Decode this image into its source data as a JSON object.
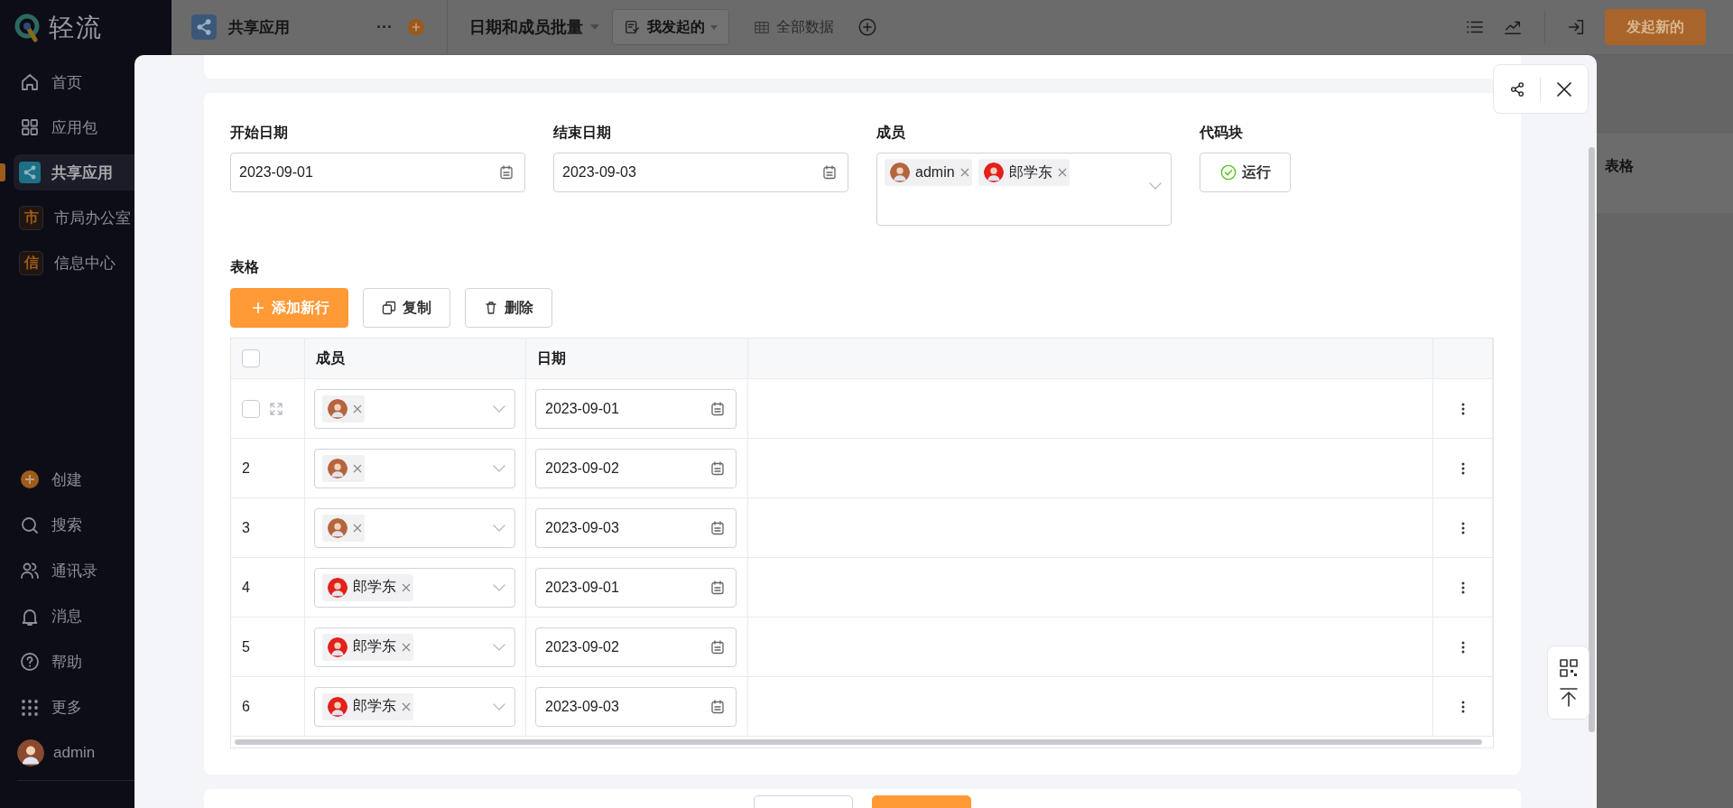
{
  "sidebar": {
    "logo": "轻流",
    "items": [
      {
        "kind": "icon",
        "label": "首页",
        "selected": false
      },
      {
        "kind": "icon",
        "label": "应用包",
        "selected": false
      },
      {
        "kind": "icon",
        "label": "共享应用",
        "selected": true
      },
      {
        "kind": "badge",
        "badge": "市",
        "label": "市局办公室",
        "selected": false
      },
      {
        "kind": "badge",
        "badge": "信",
        "label": "信息中心",
        "selected": false
      }
    ],
    "bottom_items": [
      {
        "label": "创建"
      },
      {
        "label": "搜索"
      },
      {
        "label": "通讯录"
      },
      {
        "label": "消息"
      },
      {
        "label": "帮助"
      },
      {
        "label": "更多"
      }
    ],
    "user": {
      "name": "admin",
      "color": "#8a4a2e"
    }
  },
  "topbar": {
    "app_title": "共享应用",
    "more": "···",
    "view_title": "日期和成员批量",
    "tabs": [
      {
        "label": "我发起的",
        "selected": true
      },
      {
        "label": "全部数据",
        "selected": false
      }
    ],
    "action_button": "发起新的"
  },
  "background_table": {
    "column_header": "表格"
  },
  "form": {
    "fields": [
      {
        "kind": "date",
        "label": "开始日期",
        "value": "2023-09-01"
      },
      {
        "kind": "date",
        "label": "结束日期",
        "value": "2023-09-03"
      },
      {
        "kind": "members",
        "label": "成员",
        "members": [
          {
            "name": "admin",
            "color": "#b5653e"
          },
          {
            "name": "郎学东",
            "color": "#e3201b"
          }
        ]
      },
      {
        "kind": "code",
        "label": "代码块",
        "button": "运行"
      }
    ]
  },
  "table": {
    "label": "表格",
    "buttons": [
      {
        "kind": "primary",
        "label": "添加新行"
      },
      {
        "kind": "copy",
        "label": "复制"
      },
      {
        "kind": "delete",
        "label": "删除"
      }
    ],
    "select_all": {
      "checked": false
    },
    "columns": [
      "成员",
      "日期"
    ],
    "rows": [
      {
        "hovered": true,
        "checked": false,
        "members": [
          {
            "color": "#b5653e"
          }
        ],
        "date": "2023-09-01"
      },
      {
        "hovered": false,
        "checked": false,
        "index": "2",
        "members": [
          {
            "color": "#b5653e"
          }
        ],
        "date": "2023-09-02"
      },
      {
        "hovered": false,
        "checked": false,
        "index": "3",
        "members": [
          {
            "color": "#b5653e"
          }
        ],
        "date": "2023-09-03"
      },
      {
        "hovered": false,
        "checked": false,
        "index": "4",
        "members": [
          {
            "name": "郎学东",
            "color": "#e3201b"
          }
        ],
        "date": "2023-09-01"
      },
      {
        "hovered": false,
        "checked": false,
        "index": "5",
        "members": [
          {
            "name": "郎学东",
            "color": "#e3201b"
          }
        ],
        "date": "2023-09-02"
      },
      {
        "hovered": false,
        "checked": false,
        "index": "6",
        "members": [
          {
            "name": "郎学东",
            "color": "#e3201b"
          }
        ],
        "date": "2023-09-03"
      }
    ]
  }
}
